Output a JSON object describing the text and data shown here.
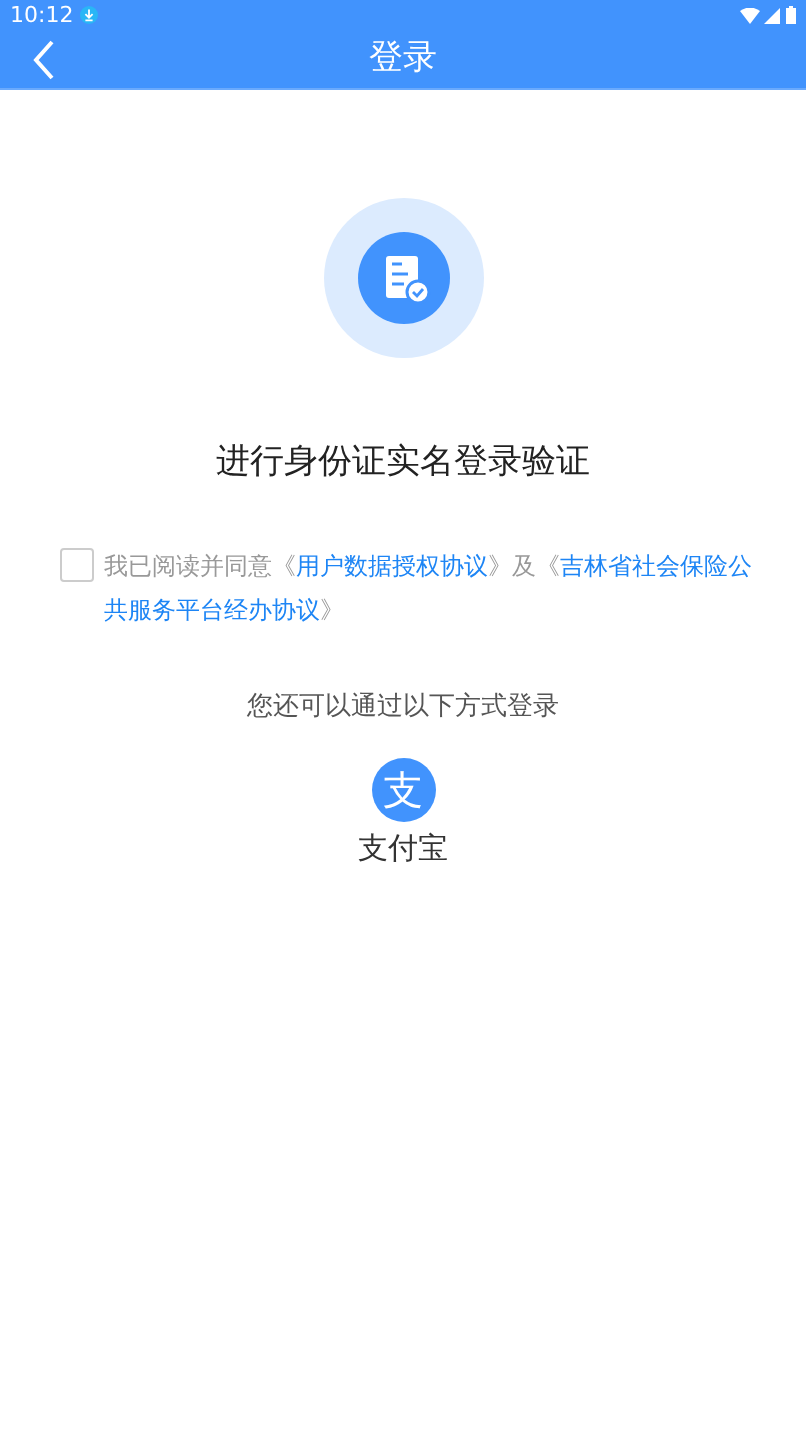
{
  "status_bar": {
    "time": "10:12"
  },
  "nav": {
    "title": "登录"
  },
  "heading": "进行身份证实名登录验证",
  "agreement": {
    "checked": false,
    "parts": [
      {
        "kind": "plain",
        "text": "我已阅读并同意《"
      },
      {
        "kind": "link",
        "text": "用户数据授权协议"
      },
      {
        "kind": "plain",
        "text": "》及《"
      },
      {
        "kind": "link",
        "text": "吉林省社会保险公共服务平台经办协议"
      },
      {
        "kind": "plain",
        "text": "》"
      }
    ]
  },
  "alt_login": {
    "prompt": "您还可以通过以下方式登录",
    "options": [
      {
        "logo": "支",
        "label": "支付宝"
      }
    ]
  }
}
